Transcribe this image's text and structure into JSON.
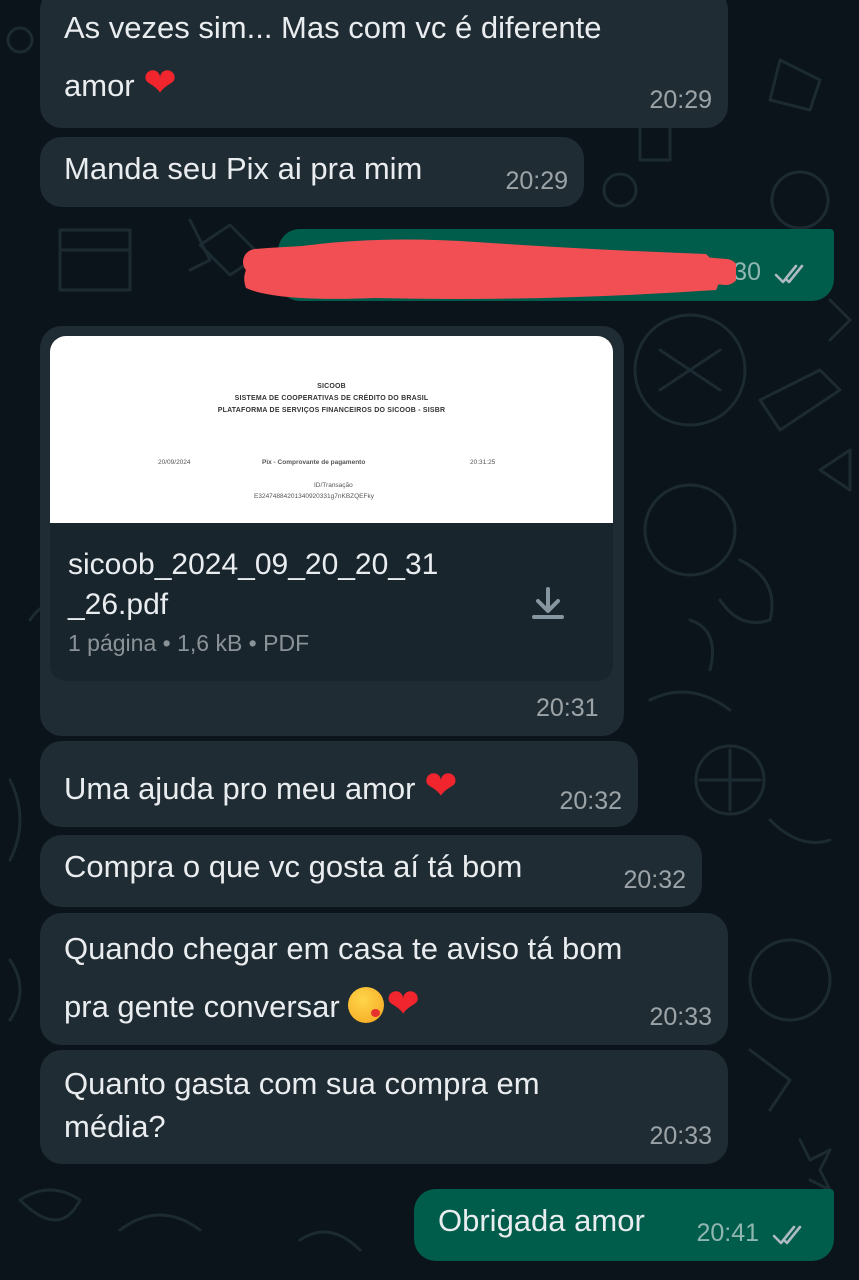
{
  "messages": [
    {
      "id": "m1",
      "direction": "in",
      "lines": [
        "As vezes sim... Mas com vc é diferente",
        "amor"
      ],
      "emoji": "❤️",
      "time": "20:29"
    },
    {
      "id": "m2",
      "direction": "in",
      "text": "Manda seu Pix ai pra mim",
      "time": "20:29"
    },
    {
      "id": "m3",
      "direction": "out",
      "text": "",
      "time_visible": "30",
      "redacted": true,
      "status": "read"
    },
    {
      "id": "m4",
      "direction": "in",
      "type": "document",
      "preview": {
        "lines": [
          "SICOOB",
          "SISTEMA DE COOPERATIVAS DE CRÉDITO DO BRASIL",
          "PLATAFORMA DE SERVIÇOS FINANCEIROS DO SICOOB - SISBR"
        ],
        "date": "20/09/2024",
        "doc_title": "Pix - Comprovante de pagamento",
        "doc_time": "20:31:25",
        "id_label": "ID/Transação",
        "id_value": "E32474884201340920331g7nKBZQEFky"
      },
      "file_name": "sicoob_2024_09_20_20_31_26.pdf",
      "file_name_lines": [
        "sicoob_2024_09_20_20_31",
        "_26.pdf"
      ],
      "file_meta": "1 página • 1,6 kB • PDF",
      "time": "20:31"
    },
    {
      "id": "m5",
      "direction": "in",
      "text": "Uma ajuda pro meu amor",
      "emoji": "❤️",
      "time": "20:32"
    },
    {
      "id": "m6",
      "direction": "in",
      "text": "Compra o que vc gosta aí tá bom",
      "time": "20:32"
    },
    {
      "id": "m7",
      "direction": "in",
      "lines": [
        "Quando chegar em casa te aviso tá bom",
        "pra gente conversar"
      ],
      "emoji": "😘❤️",
      "time": "20:33"
    },
    {
      "id": "m8",
      "direction": "in",
      "lines": [
        "Quanto gasta com sua compra em",
        "média?"
      ],
      "time": "20:33"
    },
    {
      "id": "m9",
      "direction": "out",
      "text": "Obrigada amor",
      "time": "20:41",
      "status": "read"
    }
  ],
  "colors": {
    "background": "#0b141a",
    "incoming_bubble": "#202c33",
    "outgoing_bubble": "#005c4b",
    "read_ticks": "#aebac1",
    "redaction": "#f24f54"
  },
  "icons": {
    "download": "download-icon",
    "read_ticks": "double-check-icon",
    "heart": "red-heart-emoji",
    "kiss": "face-blowing-kiss-emoji"
  }
}
